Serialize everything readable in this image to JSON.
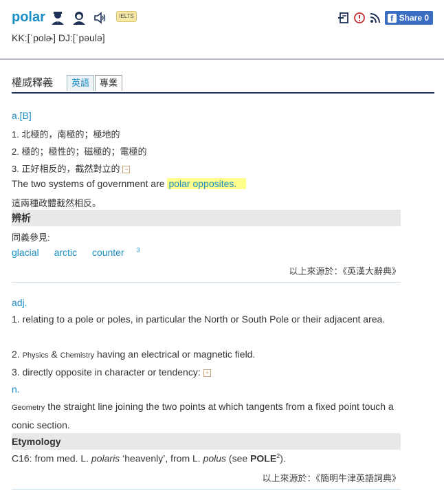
{
  "header": {
    "word": "polar",
    "ielts_badge": "IELTS",
    "pronunciation": "KK:[ˈpolɚ] DJ:[ˈpəulə]",
    "share_label": "Share 0"
  },
  "tabs": {
    "title": "權威釋義",
    "items": [
      "英語",
      "專業"
    ]
  },
  "section1": {
    "pos": "a.[B]",
    "defs": [
      "1. 北極的，南極的；極地的",
      "2. 極的；極性的；磁極的；電極的",
      "3. 正好相反的，截然對立的"
    ],
    "toggle": "−",
    "example_pre": "The two systems of government are ",
    "example_hl_word": "polar",
    "example_hl_rest": " opposites.",
    "example_zh": "這兩種政體截然相反。",
    "bar": "辨析",
    "synonym_label": "同義參見:",
    "links": [
      "glacial",
      "arctic",
      "counter"
    ],
    "link_sup": "3",
    "source": "以上來源於：《英漢大辭典》"
  },
  "section2": {
    "pos_adj": "adj.",
    "def1": "1. relating to a pole or poles, in particular the North or South Pole or their adjacent area.",
    "def2_label_a": "Physics",
    "def2_amp": "&",
    "def2_label_b": "Chemistry",
    "def2_prefix": "2.",
    "def2_text": "having an electrical or magnetic field.",
    "def3": "3. directly opposite in character or tendency:",
    "toggle": "+",
    "pos_n": "n.",
    "n_label": "Geometry",
    "n_text": "the straight line joining the two points at which tangents from a fixed point touch a conic section.",
    "bar": "Etymology",
    "ety_a": "C16: from med. L. ",
    "ety_b": "polaris",
    "ety_c": " ‘heavenly’, from L. ",
    "ety_d": "polus",
    "ety_e": " (see ",
    "ety_f": "POLE",
    "ety_sup": "2",
    "ety_g": ").",
    "source": "以上來源於：《簡明牛津英語詞典》"
  },
  "colors": {
    "accent": "#1a8fc6",
    "navy": "#1c2f57",
    "highlight": "#ffff8a"
  },
  "icons": [
    "teacher-male-icon",
    "teacher-female-icon",
    "speaker-icon",
    "notebook-icon",
    "alert-icon",
    "rss-icon",
    "facebook-icon"
  ]
}
